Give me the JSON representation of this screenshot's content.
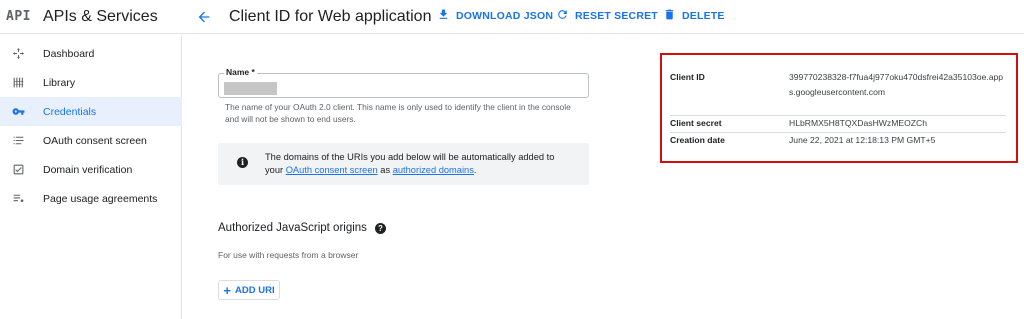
{
  "brand": {
    "logo": "API",
    "title": "APIs & Services"
  },
  "header": {
    "back_icon": "arrow-back-icon",
    "title": "Client ID for Web application",
    "actions": [
      {
        "label": "DOWNLOAD JSON",
        "icon": "download-icon"
      },
      {
        "label": "RESET SECRET",
        "icon": "refresh-icon"
      },
      {
        "label": "DELETE",
        "icon": "trash-icon"
      }
    ]
  },
  "sidebar": {
    "items": [
      {
        "label": "Dashboard",
        "icon": "dashboard-icon",
        "active": false
      },
      {
        "label": "Library",
        "icon": "library-icon",
        "active": false
      },
      {
        "label": "Credentials",
        "icon": "key-icon",
        "active": true
      },
      {
        "label": "OAuth consent screen",
        "icon": "consent-icon",
        "active": false
      },
      {
        "label": "Domain verification",
        "icon": "checkbox-icon",
        "active": false
      },
      {
        "label": "Page usage agreements",
        "icon": "settings-list-icon",
        "active": false
      }
    ]
  },
  "form": {
    "name_label": "Name *",
    "name_hint": "The name of your OAuth 2.0 client. This name is only used to identify the client in the console and will not be shown to end users.",
    "info": {
      "text_before": "The domains of the URIs you add below will be automatically added to your",
      "link1": "OAuth consent screen",
      "middle": "as",
      "link2": "authorized domains",
      "end": "."
    },
    "origins_title": "Authorized JavaScript origins",
    "origins_subtitle": "For use with requests from a browser",
    "add_uri_label": "ADD URI"
  },
  "details": {
    "client_id_label": "Client ID",
    "client_id_value": "399770238328-f7fua4j977oku470dsfrei42a35103oe.apps.googleusercontent.com",
    "client_secret_label": "Client secret",
    "client_secret_value": "HLbRMX5H8TQXDasHWzMEOZCh",
    "creation_date_label": "Creation date",
    "creation_date_value": "June 22, 2021 at 12:18:13 PM GMT+5"
  },
  "colors": {
    "accent": "#1a73e8",
    "highlight_border": "#d10f0f",
    "active_bg": "#e8f0fe"
  }
}
